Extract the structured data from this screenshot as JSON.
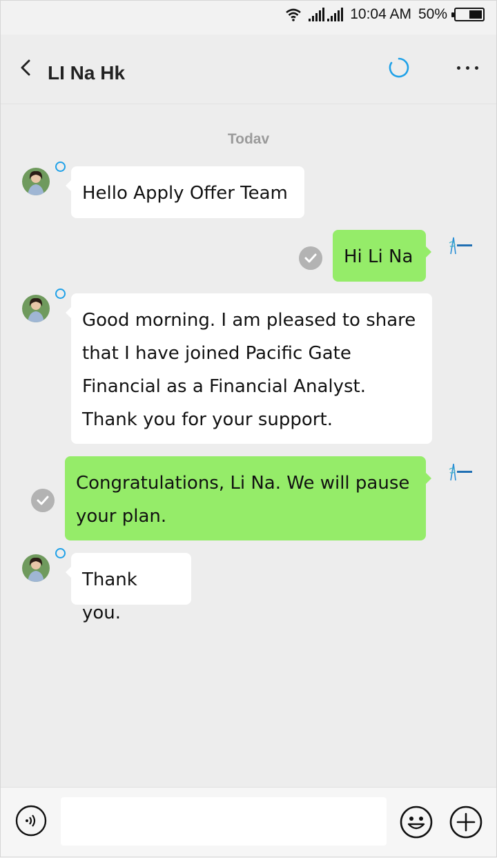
{
  "status_bar": {
    "time": "10:04 AM",
    "battery": "50%",
    "battery_level": 0.5,
    "icons": [
      "wifi-icon",
      "signal-icon",
      "signal-icon",
      "battery-icon"
    ]
  },
  "header": {
    "title": "LI Na Hk",
    "icons": [
      "back-arrow-icon",
      "loading-spinner-icon",
      "more-options-icon"
    ]
  },
  "date_label": "Todav",
  "messages": [
    {
      "side": "incoming",
      "text": "Hello Apply Offer Team"
    },
    {
      "side": "outgoing",
      "text": "Hi Li Na"
    },
    {
      "side": "incoming",
      "lines": [
        "Good morning. I am pleased to share",
        "that I have joined Pacific Gate",
        "Financial as a Financial Analyst.",
        "Thank you for your support."
      ]
    },
    {
      "side": "outgoing",
      "lines": [
        "Congratulations, Li Na. We will pause",
        "your plan."
      ]
    },
    {
      "side": "incoming",
      "text": "Thank you."
    }
  ],
  "input_bar": {
    "icons": [
      "voice-icon",
      "emoji-icon",
      "plus-icon"
    ]
  },
  "colors": {
    "background": "#ededed",
    "incoming_bubble": "#ffffff",
    "outgoing_bubble": "#95ec69",
    "accent": "#1fa1e8"
  }
}
